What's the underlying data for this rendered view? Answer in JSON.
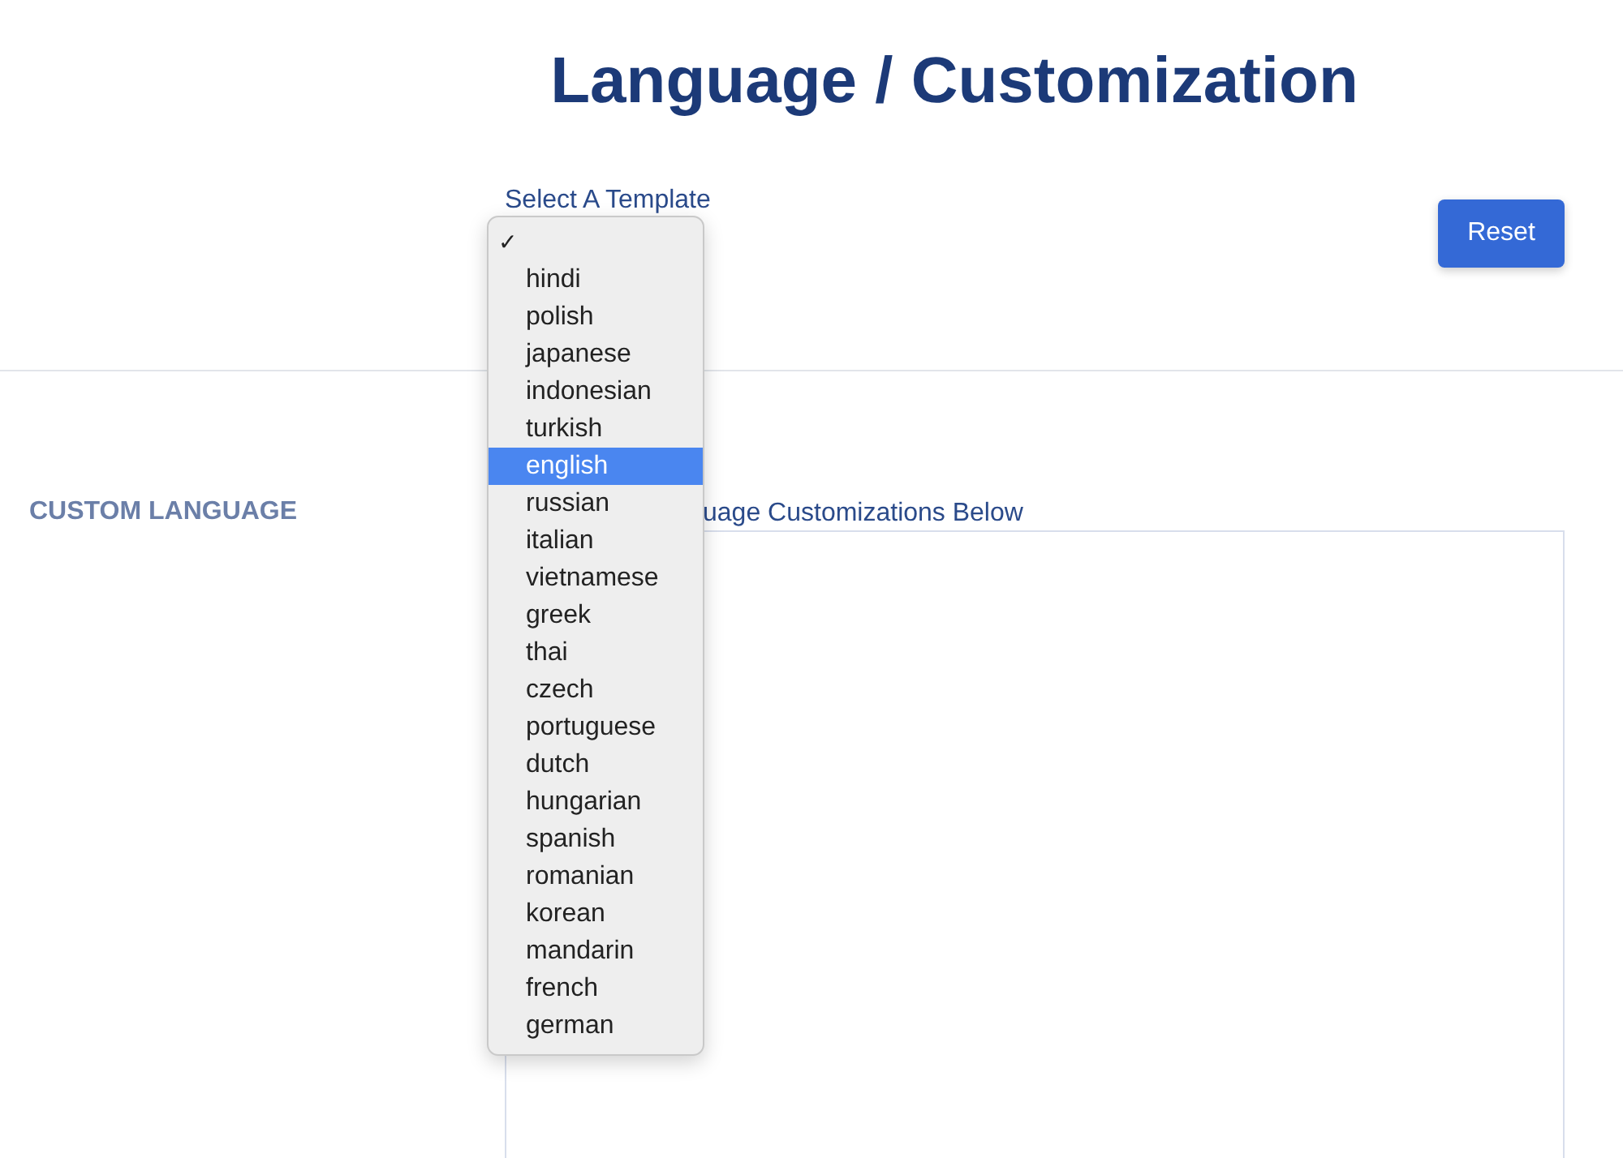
{
  "page": {
    "title": "Language / Customization"
  },
  "template": {
    "label": "Select A Template",
    "menu": [
      {
        "kind": "check",
        "label": "✓",
        "selected": false
      },
      {
        "kind": "option",
        "label": "hindi",
        "selected": false
      },
      {
        "kind": "option",
        "label": "polish",
        "selected": false
      },
      {
        "kind": "option",
        "label": "japanese",
        "selected": false
      },
      {
        "kind": "option",
        "label": "indonesian",
        "selected": false
      },
      {
        "kind": "option",
        "label": "turkish",
        "selected": false
      },
      {
        "kind": "option",
        "label": "english",
        "selected": true
      },
      {
        "kind": "option",
        "label": "russian",
        "selected": false
      },
      {
        "kind": "option",
        "label": "italian",
        "selected": false
      },
      {
        "kind": "option",
        "label": "vietnamese",
        "selected": false
      },
      {
        "kind": "option",
        "label": "greek",
        "selected": false
      },
      {
        "kind": "option",
        "label": "thai",
        "selected": false
      },
      {
        "kind": "option",
        "label": "czech",
        "selected": false
      },
      {
        "kind": "option",
        "label": "portuguese",
        "selected": false
      },
      {
        "kind": "option",
        "label": "dutch",
        "selected": false
      },
      {
        "kind": "option",
        "label": "hungarian",
        "selected": false
      },
      {
        "kind": "option",
        "label": "spanish",
        "selected": false
      },
      {
        "kind": "option",
        "label": "romanian",
        "selected": false
      },
      {
        "kind": "option",
        "label": "korean",
        "selected": false
      },
      {
        "kind": "option",
        "label": "mandarin",
        "selected": false
      },
      {
        "kind": "option",
        "label": "french",
        "selected": false
      },
      {
        "kind": "option",
        "label": "german",
        "selected": false
      }
    ]
  },
  "reset_button": "Reset",
  "custom_language": {
    "heading": "CUSTOM LANGUAGE",
    "field_label": "uage Customizations Below"
  }
}
